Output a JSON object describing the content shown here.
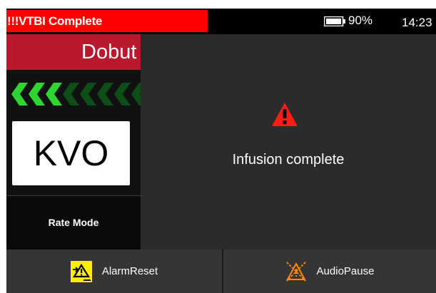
{
  "status_bar": {
    "alarm_text": "!!!VTBI Complete",
    "battery_percent": "90%",
    "time": "14:23"
  },
  "channel": {
    "drug_name": "Dobut",
    "rate_value": "KVO",
    "mode_label": "Rate Mode"
  },
  "message": {
    "text": "Infusion complete"
  },
  "softkeys": {
    "left_label": "AlarmReset",
    "right_label": "AudioPause"
  },
  "colors": {
    "alarm_red": "#ff0000",
    "drug_header": "#b8192c",
    "chevron_active": "#2fd62f",
    "chevron_inactive": "#0d4d18",
    "alarm_reset_icon_bg": "#ffee00",
    "audio_pause_icon": "#ff8a00"
  }
}
